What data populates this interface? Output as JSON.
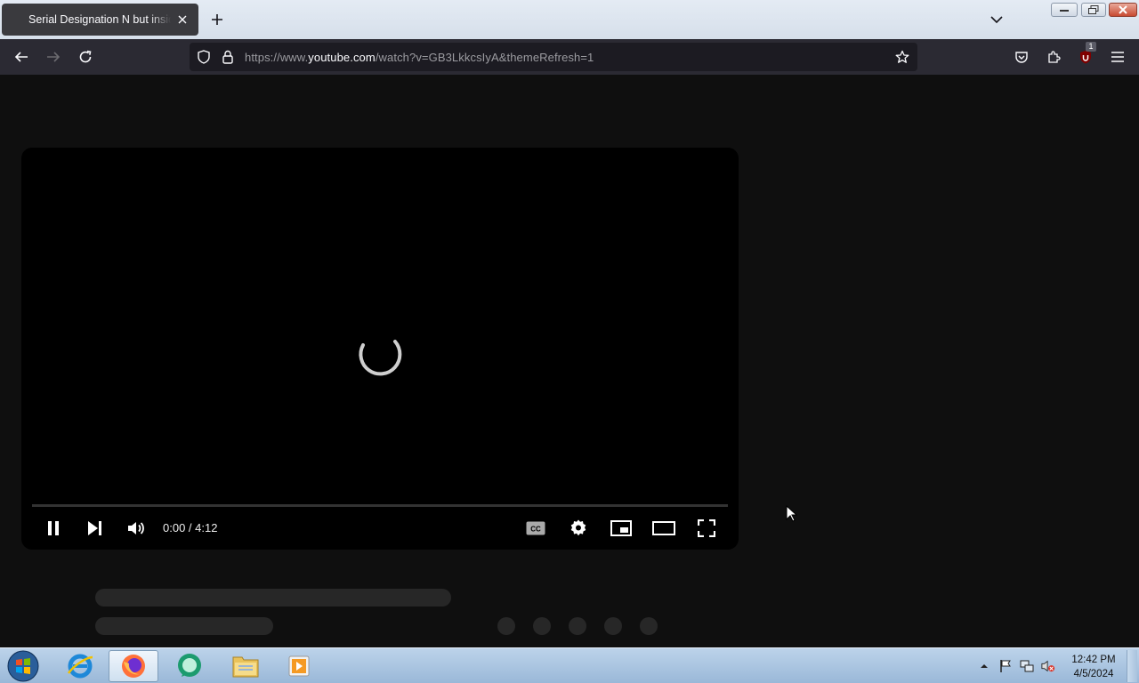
{
  "browser": {
    "tab_title": "Serial Designation N but inside",
    "url_prefix": "https://www.",
    "url_host": "youtube.com",
    "url_path": "/watch?v=GB3LkkcsIyA&themeRefresh=1",
    "extension_badge": "1"
  },
  "player": {
    "time_display": "0:00 / 4:12",
    "progress": 0
  },
  "taskbar": {
    "clock_time": "12:42 PM",
    "clock_date": "4/5/2024"
  }
}
